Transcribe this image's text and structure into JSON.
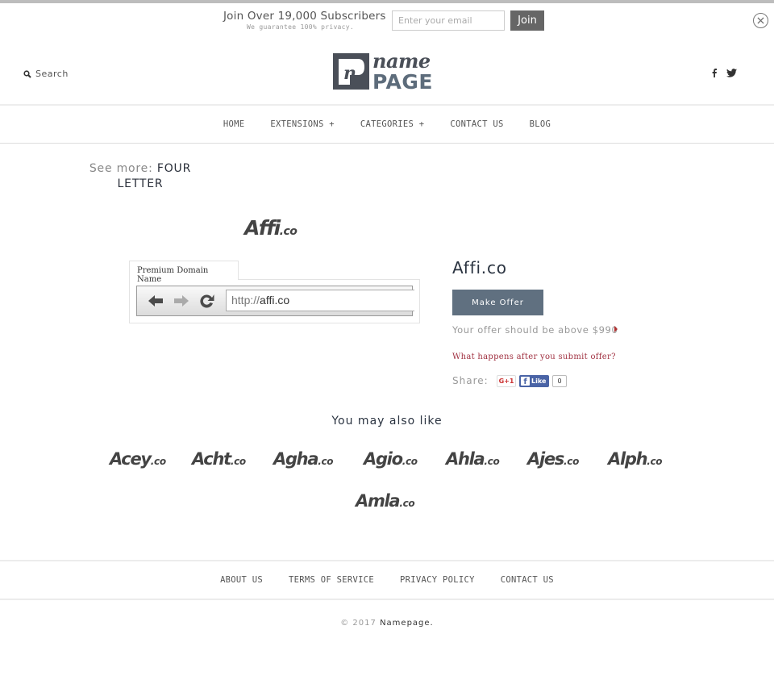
{
  "subscribe": {
    "title": "Join Over 19,000 Subscribers",
    "note": "We guarantee 100% privacy.",
    "email_placeholder": "Enter your email",
    "email_value": "",
    "join_label": "Join"
  },
  "header": {
    "search_label": "Search",
    "logo": {
      "top": "name",
      "bottom": "PAGE",
      "mark": "n"
    },
    "social": [
      "facebook",
      "twitter"
    ]
  },
  "nav": {
    "items": [
      {
        "label": "HOME"
      },
      {
        "label": "EXTENSIONS +"
      },
      {
        "label": "CATEGORIES +"
      },
      {
        "label": "CONTACT US"
      },
      {
        "label": "BLOG"
      }
    ]
  },
  "see_more": {
    "label": "See more:",
    "value": "FOUR LETTER"
  },
  "domain": {
    "logo_name": "Affi",
    "logo_tld": ".co",
    "tab_label": "Premium Domain Name",
    "url_prefix": "http://",
    "url_domain": "affi.co",
    "title": "Affi.co",
    "offer_button": "Make Offer",
    "offer_note": "Your offer should be above $990",
    "what_happens": "What happens after you submit offer?",
    "share_label": "Share:",
    "gplus_label": "G+1",
    "fb_label": "Like",
    "like_count": "0"
  },
  "related": {
    "heading": "You may also like",
    "items": [
      {
        "name": "Acey",
        "tld": ".co"
      },
      {
        "name": "Acht",
        "tld": ".co"
      },
      {
        "name": "Agha",
        "tld": ".co"
      },
      {
        "name": "Agio",
        "tld": ".co"
      },
      {
        "name": "Ahla",
        "tld": ".co"
      },
      {
        "name": "Ajes",
        "tld": ".co"
      },
      {
        "name": "Alph",
        "tld": ".co"
      },
      {
        "name": "Amla",
        "tld": ".co"
      }
    ]
  },
  "footer": {
    "links": [
      {
        "label": "ABOUT US"
      },
      {
        "label": "TERMS OF SERVICE"
      },
      {
        "label": "PRIVACY POLICY"
      },
      {
        "label": "CONTACT US"
      }
    ],
    "copyright_prefix": "© 2017",
    "copyright_brand": "Namepage."
  }
}
